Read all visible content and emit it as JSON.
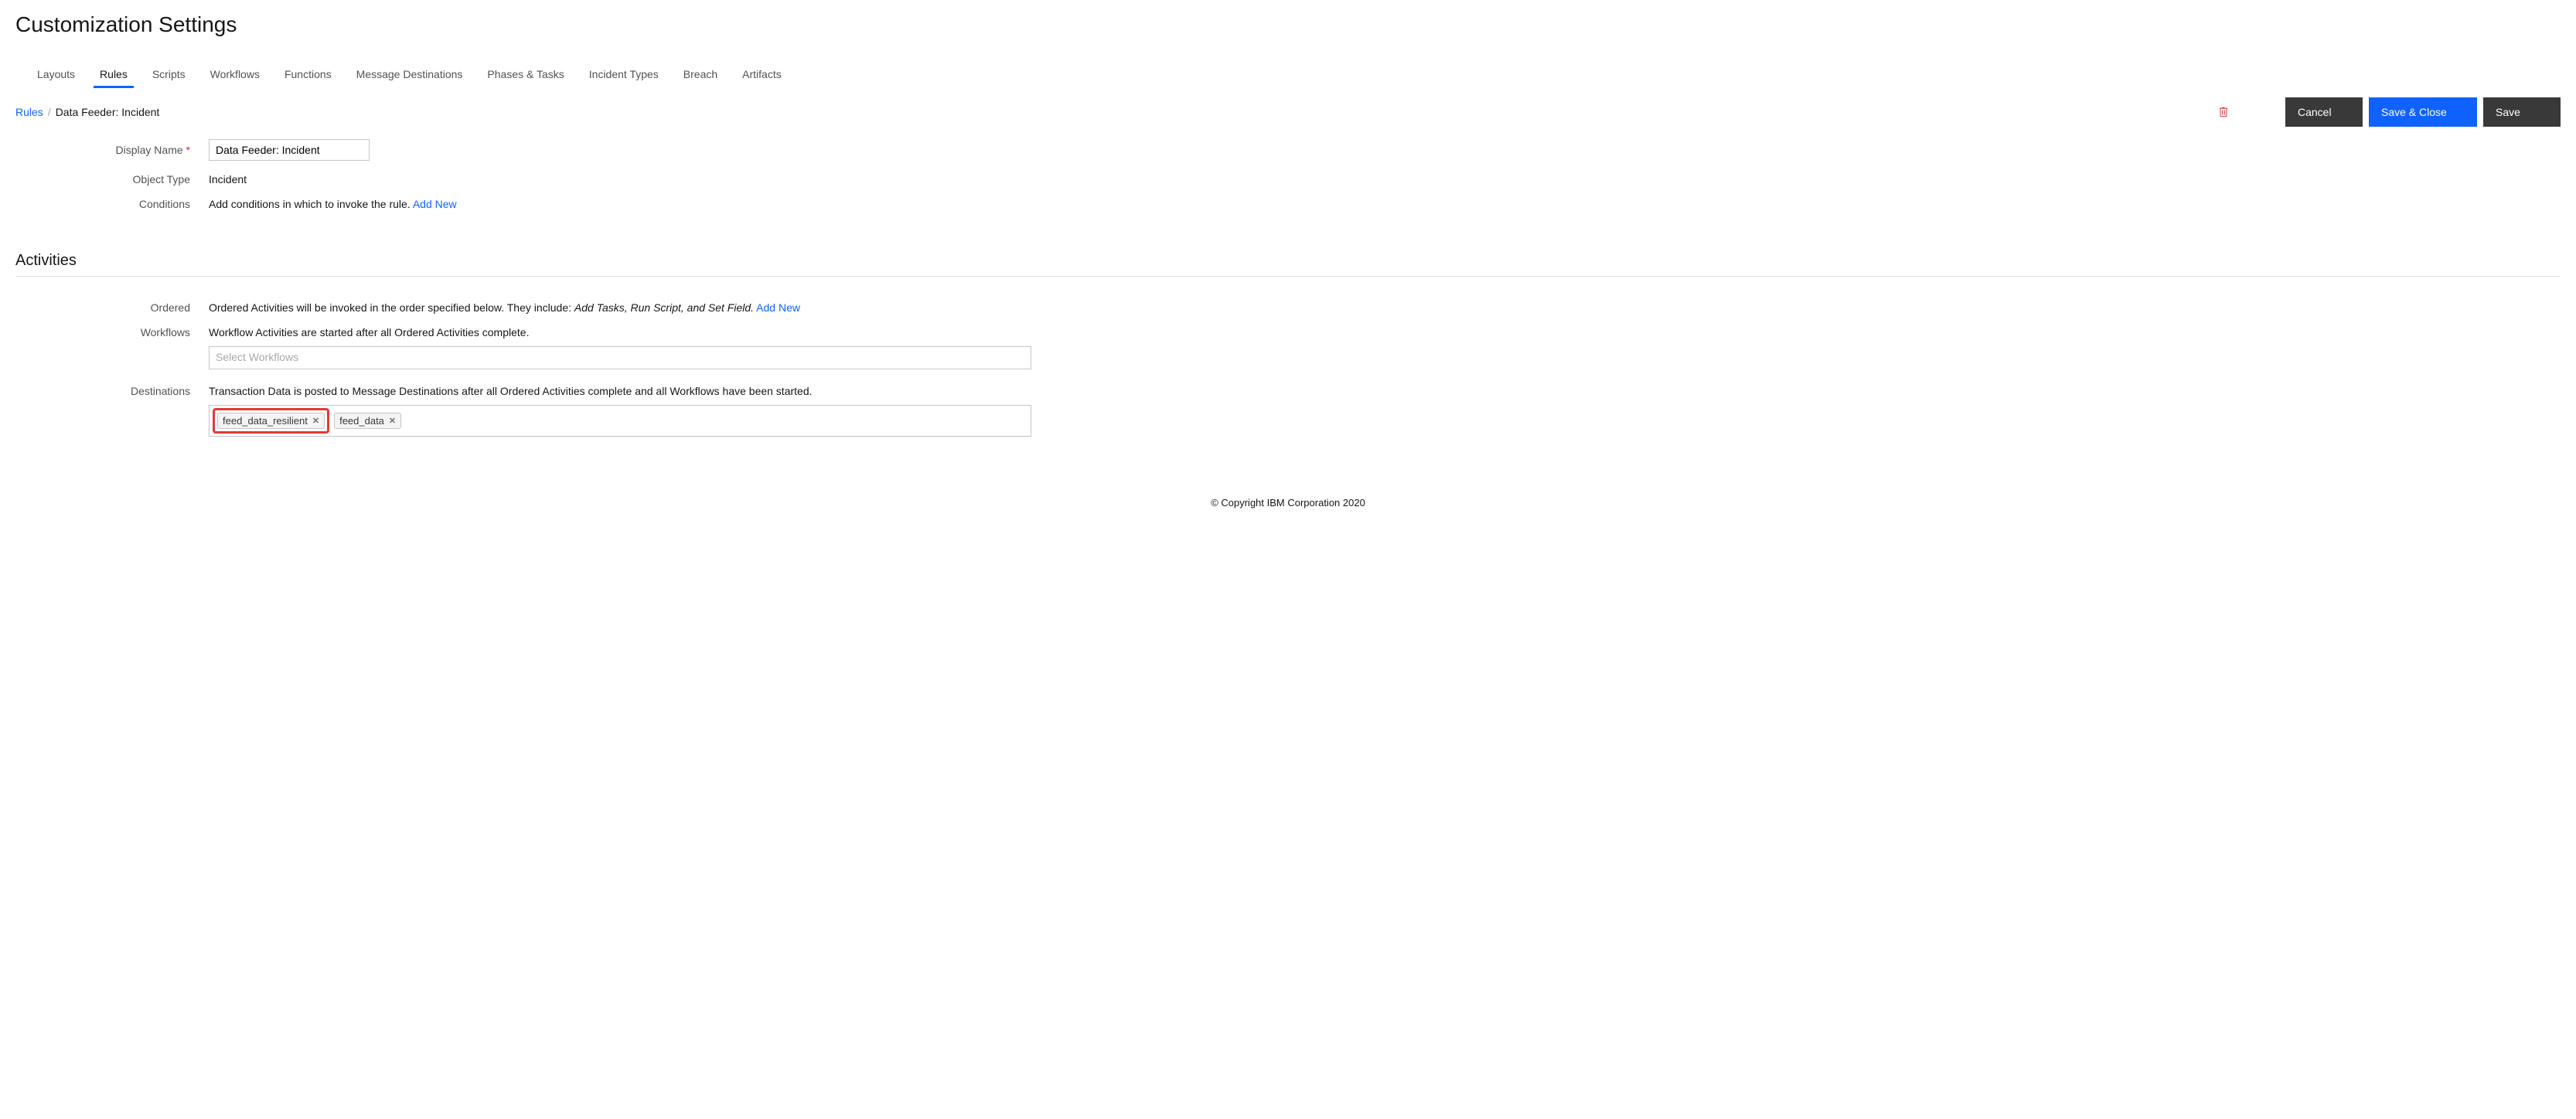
{
  "page_title": "Customization Settings",
  "tabs": [
    "Layouts",
    "Rules",
    "Scripts",
    "Workflows",
    "Functions",
    "Message Destinations",
    "Phases & Tasks",
    "Incident Types",
    "Breach",
    "Artifacts"
  ],
  "active_tab": "Rules",
  "breadcrumb": {
    "root": "Rules",
    "separator": "/",
    "current": "Data Feeder: Incident"
  },
  "buttons": {
    "cancel": "Cancel",
    "save_close": "Save & Close",
    "save": "Save"
  },
  "form": {
    "display_name_label": "Display Name",
    "display_name_value": "Data Feeder: Incident",
    "object_type_label": "Object Type",
    "object_type_value": "Incident",
    "conditions_label": "Conditions",
    "conditions_text": "Add conditions in which to invoke the rule.",
    "conditions_link": "Add New"
  },
  "activities": {
    "heading": "Activities",
    "ordered_label": "Ordered",
    "ordered_text": "Ordered Activities will be invoked in the order specified below. They include: ",
    "ordered_italic": "Add Tasks, Run Script, and Set Field.",
    "ordered_link": "Add New",
    "workflows_label": "Workflows",
    "workflows_text": "Workflow Activities are started after all Ordered Activities complete.",
    "workflows_placeholder": "Select Workflows",
    "destinations_label": "Destinations",
    "destinations_text": "Transaction Data is posted to Message Destinations after all Ordered Activities complete and all Workflows have been started.",
    "destination_tags": [
      "feed_data_resilient",
      "feed_data"
    ]
  },
  "footer": "© Copyright IBM Corporation 2020"
}
